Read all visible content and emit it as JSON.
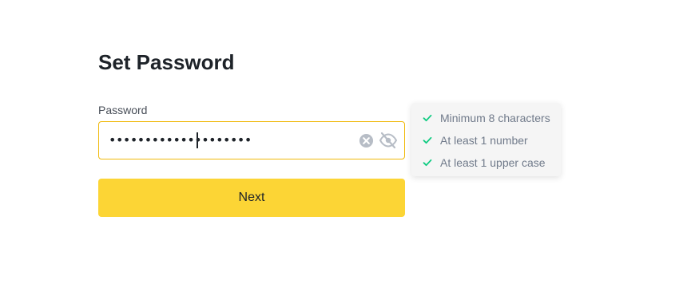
{
  "page": {
    "title": "Set Password"
  },
  "password_field": {
    "label": "Password",
    "value": "••••••••••••••••••••",
    "clear_icon": "clear-circle-icon",
    "visibility_icon": "eye-slash-icon"
  },
  "next_button": {
    "label": "Next"
  },
  "requirements": {
    "items": [
      {
        "text": "Minimum 8 characters",
        "status": "met"
      },
      {
        "text": "At least 1 number",
        "status": "met"
      },
      {
        "text": "At least 1 upper case",
        "status": "met"
      }
    ]
  },
  "colors": {
    "accent": "#fcd535",
    "input_border_focus": "#f0b90b",
    "check_green": "#0ecb81",
    "text_primary": "#1e2329",
    "text_secondary": "#707a8a"
  }
}
